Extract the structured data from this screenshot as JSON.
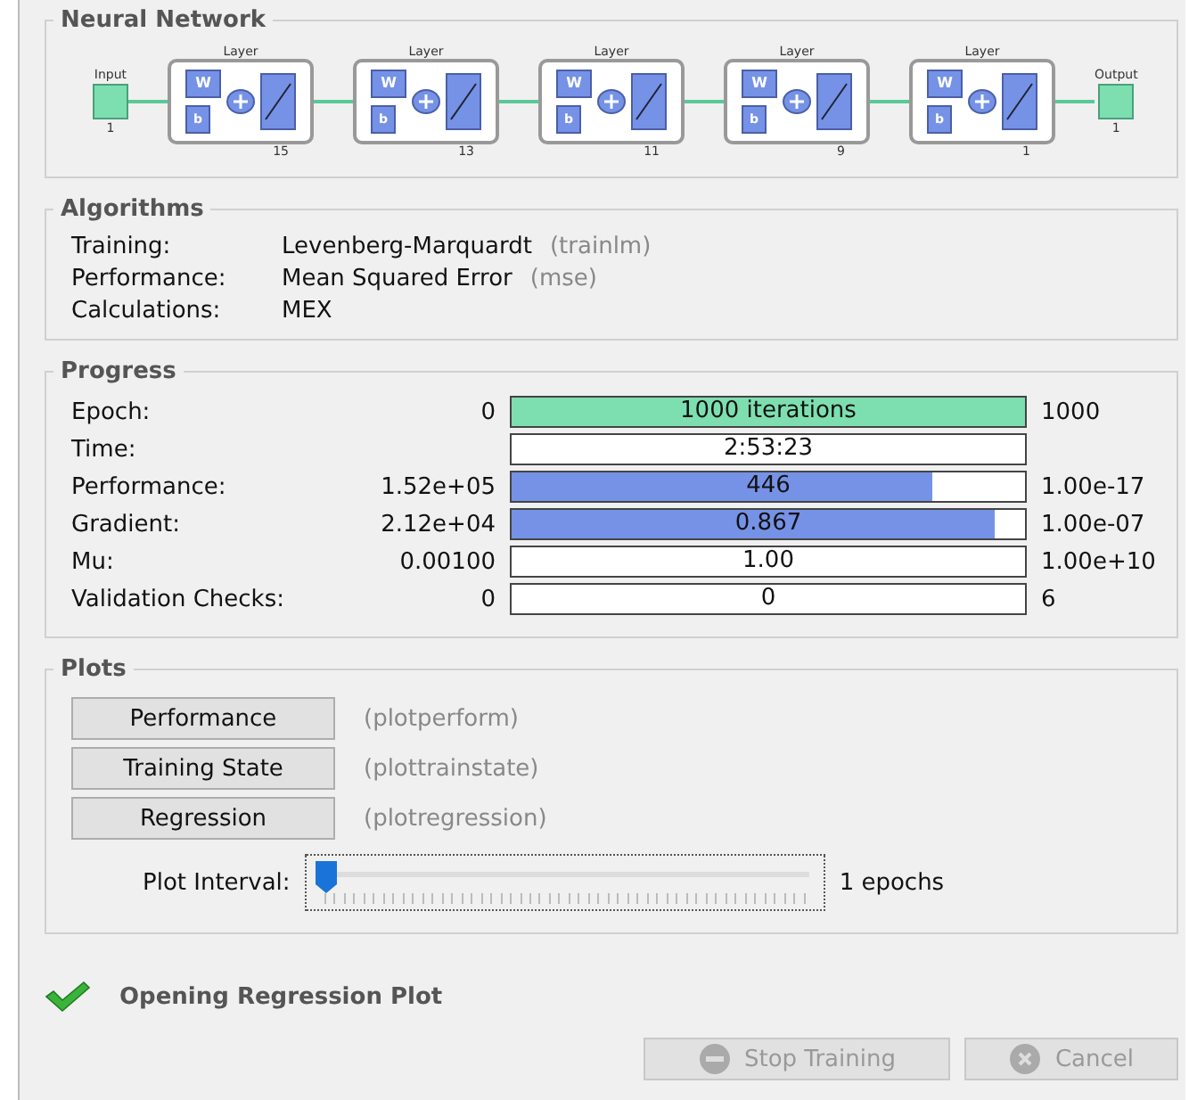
{
  "network": {
    "title": "Neural Network",
    "input": {
      "label": "Input",
      "size": "1"
    },
    "layers": [
      {
        "label": "Layer",
        "w": "W",
        "b": "b",
        "size": "15"
      },
      {
        "label": "Layer",
        "w": "W",
        "b": "b",
        "size": "13"
      },
      {
        "label": "Layer",
        "w": "W",
        "b": "b",
        "size": "11"
      },
      {
        "label": "Layer",
        "w": "W",
        "b": "b",
        "size": "9"
      },
      {
        "label": "Layer",
        "w": "W",
        "b": "b",
        "size": "1"
      }
    ],
    "output": {
      "label": "Output",
      "size": "1"
    }
  },
  "algorithms": {
    "title": "Algorithms",
    "rows": [
      {
        "label": "Training:",
        "value": "Levenberg-Marquardt",
        "code": "(trainlm)"
      },
      {
        "label": "Performance:",
        "value": "Mean Squared Error",
        "code": "(mse)"
      },
      {
        "label": "Calculations:",
        "value": "MEX"
      }
    ]
  },
  "progress": {
    "title": "Progress",
    "rows": [
      {
        "label": "Epoch:",
        "start": "0",
        "bar": "1000 iterations",
        "level": 1,
        "color": "#7ddfb0",
        "end": "1000"
      },
      {
        "label": "Time:",
        "bar": "2:53:23"
      },
      {
        "label": "Performance:",
        "start": "1.52e+05",
        "bar": "446",
        "level": 0.82,
        "color": "#7592e6",
        "end": "1.00e-17"
      },
      {
        "label": "Gradient:",
        "start": "2.12e+04",
        "bar": "0.867",
        "level": 0.94,
        "color": "#7592e6",
        "end": "1.00e-07"
      },
      {
        "label": "Mu:",
        "start": "0.00100",
        "bar": "1.00",
        "end": "1.00e+10"
      },
      {
        "label": "Validation Checks:",
        "start": "0",
        "bar": "0",
        "end": "6"
      }
    ]
  },
  "plots": {
    "title": "Plots",
    "buttons": [
      {
        "label": "Performance",
        "code": "(plotperform)"
      },
      {
        "label": "Training State",
        "code": "(plottrainstate)"
      },
      {
        "label": "Regression",
        "code": "(plotregression)"
      }
    ],
    "interval": {
      "label": "Plot Interval:",
      "level": 0,
      "reading": "1 epochs"
    }
  },
  "status": {
    "text": "Opening Regression Plot"
  },
  "buttons": [
    {
      "label": "Stop Training",
      "kind": "stop",
      "disabled": true
    },
    {
      "label": "Cancel",
      "kind": "cancel",
      "disabled": true
    }
  ]
}
